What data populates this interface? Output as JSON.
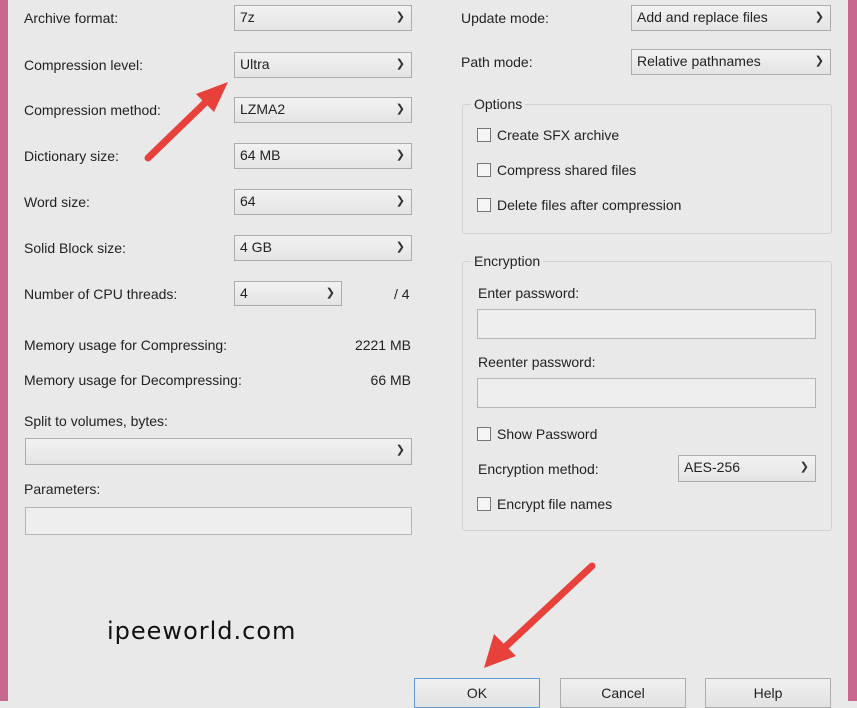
{
  "left": {
    "rows": [
      {
        "label": "Archive format:",
        "value": "7z"
      },
      {
        "label": "Compression level:",
        "value": "Ultra"
      },
      {
        "label": "Compression method:",
        "value": "LZMA2"
      },
      {
        "label": "Dictionary size:",
        "value": "64 MB"
      },
      {
        "label": "Word size:",
        "value": "64"
      },
      {
        "label": "Solid Block size:",
        "value": "4 GB"
      }
    ],
    "cpu": {
      "label": "Number of CPU threads:",
      "value": "4",
      "max": "/ 4"
    },
    "mem_compress": {
      "label": "Memory usage for Compressing:",
      "value": "2221 MB"
    },
    "mem_decompress": {
      "label": "Memory usage for Decompressing:",
      "value": "66 MB"
    },
    "split": {
      "label": "Split to volumes, bytes:",
      "value": ""
    },
    "params": {
      "label": "Parameters:",
      "value": ""
    }
  },
  "right": {
    "update_mode": {
      "label": "Update mode:",
      "value": "Add and replace files"
    },
    "path_mode": {
      "label": "Path mode:",
      "value": "Relative pathnames"
    },
    "options": {
      "title": "Options",
      "items": [
        "Create SFX archive",
        "Compress shared files",
        "Delete files after compression"
      ]
    },
    "encryption": {
      "title": "Encryption",
      "enter_label": "Enter password:",
      "reenter_label": "Reenter password:",
      "show_password": "Show Password",
      "method_label": "Encryption method:",
      "method_value": "AES-256",
      "encrypt_names": "Encrypt file names"
    }
  },
  "buttons": {
    "ok": "OK",
    "cancel": "Cancel",
    "help": "Help"
  },
  "watermark": "ipeeworld.com",
  "colors": {
    "arrow": "#e8403a",
    "frame": "#c8678f"
  }
}
